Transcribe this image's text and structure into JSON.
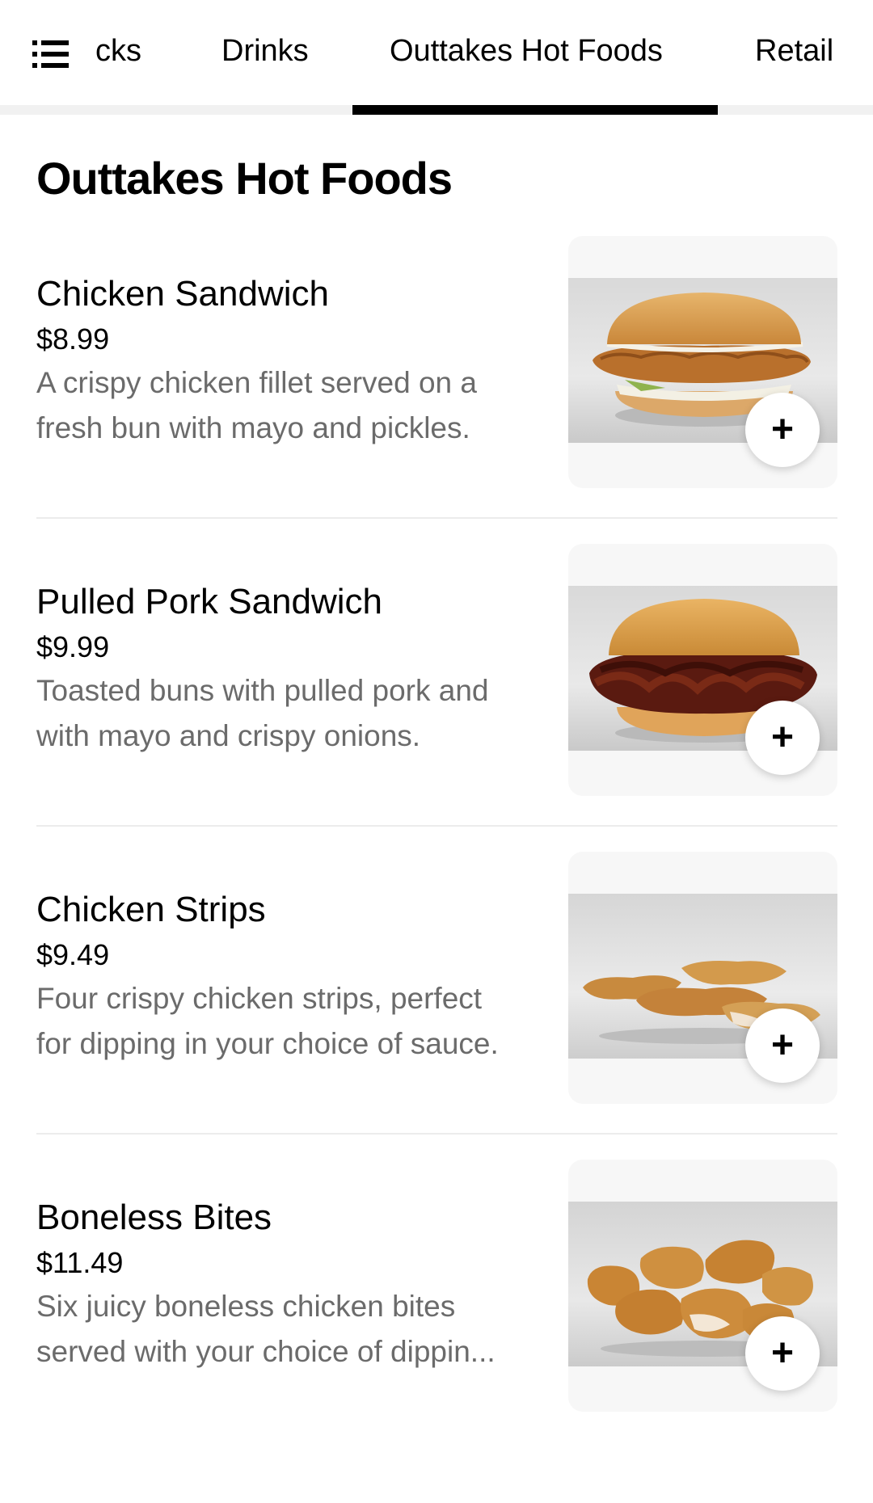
{
  "tabs": {
    "items": [
      {
        "label": "Snacks",
        "visible_label": "cks",
        "active": false
      },
      {
        "label": "Drinks",
        "active": false
      },
      {
        "label": "Outtakes Hot Foods",
        "active": true
      },
      {
        "label": "Retail",
        "active": false
      }
    ]
  },
  "section": {
    "title": "Outtakes Hot Foods"
  },
  "items": [
    {
      "name": "Chicken Sandwich",
      "price": "$8.99",
      "description_lines": [
        "A crispy chicken fillet served on a",
        "fresh bun with mayo and pickles."
      ],
      "image": "chicken-sandwich-photo",
      "add_label": "+"
    },
    {
      "name": "Pulled Pork Sandwich",
      "price": "$9.99",
      "description_lines": [
        "Toasted buns with pulled pork and",
        "with mayo and crispy onions."
      ],
      "image": "pulled-pork-sandwich-photo",
      "add_label": "+"
    },
    {
      "name": "Chicken Strips",
      "price": "$9.49",
      "description_lines": [
        "Four crispy chicken strips, perfect",
        "for dipping in your choice of sauce."
      ],
      "image": "chicken-strips-photo",
      "add_label": "+"
    },
    {
      "name": "Boneless Bites",
      "price": "$11.49",
      "description_lines": [
        "Six juicy boneless chicken bites",
        "served with your choice of dippin..."
      ],
      "image": "boneless-bites-photo",
      "add_label": "+"
    }
  ],
  "icons": {
    "menu": "list-menu-icon",
    "add": "plus-icon"
  },
  "colors": {
    "accent": "#000000",
    "secondary_text": "#6b6b6b",
    "card_background": "#f7f7f7"
  }
}
